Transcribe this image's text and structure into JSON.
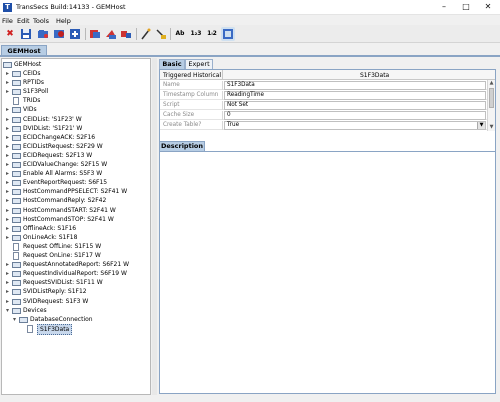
{
  "window": {
    "title": "TransSecs Build:14133 - GEMHost",
    "app_icon_letter": "T",
    "minimize_glyph": "–",
    "maximize_glyph": "□",
    "close_glyph": "✕"
  },
  "menu": {
    "file": "File",
    "edit": "Edit",
    "tools": "Tools",
    "help": "Help"
  },
  "toolbar": {
    "icons": [
      "delete-icon",
      "save-icon",
      "open-icon",
      "settings-icon",
      "new-icon",
      "copy-icon",
      "paste-icon",
      "cut-icon",
      "wand-icon",
      "clear-icon",
      "sort-alpha-icon",
      "sort-numeric-icon",
      "sort-z-icon",
      "refresh-icon"
    ]
  },
  "document_tab": "GEMHost",
  "tree": {
    "root": "GEMHost",
    "items": [
      {
        "label": "CEIDs",
        "type": "folder",
        "expanded": false
      },
      {
        "label": "RPTIDs",
        "type": "folder",
        "expanded": false
      },
      {
        "label": "S1F3Poll",
        "type": "folder",
        "expanded": false
      },
      {
        "label": "TRIDs",
        "type": "doc"
      },
      {
        "label": "VIDs",
        "type": "folder",
        "expanded": false
      },
      {
        "label": "CEIDList: 'S1F23' W",
        "type": "folder",
        "expanded": false
      },
      {
        "label": "DVIDList: 'S1F21' W",
        "type": "folder",
        "expanded": false
      },
      {
        "label": "ECIDChangeACK: S2F16",
        "type": "folder",
        "expanded": false
      },
      {
        "label": "ECIDListRequest: S2F29 W",
        "type": "folder",
        "expanded": false
      },
      {
        "label": "ECIDRequest: S2F13 W",
        "type": "folder",
        "expanded": false
      },
      {
        "label": "ECIDValueChange: S2F15 W",
        "type": "folder",
        "expanded": false
      },
      {
        "label": "Enable All Alarms: S5F3 W",
        "type": "folder",
        "expanded": false
      },
      {
        "label": "EventReportRequest: S6F15",
        "type": "folder",
        "expanded": false
      },
      {
        "label": "HostCommandPPSELECT: S2F41 W",
        "type": "folder",
        "expanded": false
      },
      {
        "label": "HostCommandReply: S2F42",
        "type": "folder",
        "expanded": false
      },
      {
        "label": "HostCommandSTART: S2F41 W",
        "type": "folder",
        "expanded": false
      },
      {
        "label": "HostCommandSTOP: S2F41 W",
        "type": "folder",
        "expanded": false
      },
      {
        "label": "OfflineAck: S1F16",
        "type": "folder",
        "expanded": false
      },
      {
        "label": "OnLineAck: S1F18",
        "type": "folder",
        "expanded": false
      },
      {
        "label": "Request OffLine: S1F15 W",
        "type": "doc"
      },
      {
        "label": "Request OnLine: S1F17 W",
        "type": "doc"
      },
      {
        "label": "RequestAnnotatedReport: S6F21 W",
        "type": "folder",
        "expanded": false
      },
      {
        "label": "RequestIndividualReport: S6F19 W",
        "type": "folder",
        "expanded": false
      },
      {
        "label": "RequestSVIDList: S1F11 W",
        "type": "folder",
        "expanded": false
      },
      {
        "label": "SVIDListReply: S1F12",
        "type": "folder",
        "expanded": false
      },
      {
        "label": "SVIDRequest: S1F3 W",
        "type": "folder",
        "expanded": false
      },
      {
        "label": "Devices",
        "type": "folder",
        "expanded": true
      },
      {
        "label": "DatabaseConnection",
        "type": "folder",
        "expanded": true,
        "level": 2
      },
      {
        "label": "S1F3Data",
        "type": "doc",
        "level": 3,
        "selected": true
      }
    ]
  },
  "right": {
    "tabs": [
      "Basic",
      "Expert"
    ],
    "header_left": "Triggered Historical",
    "header_right": "S1F3Data",
    "properties": [
      {
        "name": "Name",
        "value": "S1F3Data"
      },
      {
        "name": "Timestamp Column",
        "value": "ReadingTime"
      },
      {
        "name": "Script",
        "value": "Not Set"
      },
      {
        "name": "Cache Size",
        "value": "0"
      },
      {
        "name": "Create Table?",
        "value": "True"
      }
    ],
    "description_tab": "Description"
  },
  "colors": {
    "accent": "#b7cde4",
    "border": "#8aa4c4"
  }
}
